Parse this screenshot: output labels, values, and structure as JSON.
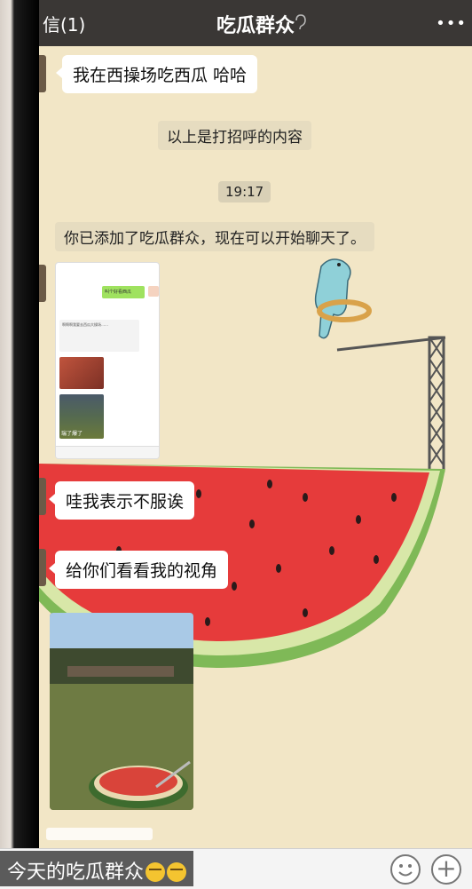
{
  "header": {
    "back_label": "信(1)",
    "title": "吃瓜群众"
  },
  "messages": {
    "msg1": "我在西操场吃西瓜  哈哈",
    "sys_hello": "以上是打招呼的内容",
    "time": "19:17",
    "sys_added": "你已添加了吃瓜群众，现在可以开始聊天了。",
    "msg2": "哇我表示不服诶",
    "msg3": "给你们看看我的视角"
  },
  "screenshot_thumb": {
    "green_bubble": "叫个好看西瓜",
    "text_bubble": "啊啊啊我要去西瓜大操场……",
    "tag": "瑞了爆了"
  },
  "caption": {
    "text": "今天的吃瓜群众"
  },
  "icons": {
    "back": "back-chevron-icon",
    "ear": "ear-icon",
    "more": "more-dots-icon",
    "emoji": "smirk-face-icon",
    "smile": "emoji-button-icon",
    "plus": "plus-icon"
  },
  "colors": {
    "titlebar": "#3a3735",
    "chat_bg": "#f2e6c6",
    "melon_red": "#e63b3b",
    "melon_green": "#5e9f46"
  }
}
